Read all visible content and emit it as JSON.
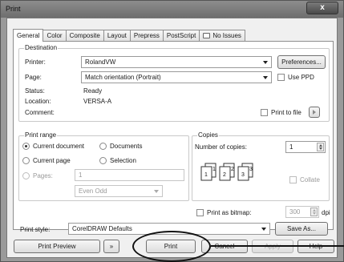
{
  "window": {
    "title": "Print",
    "close_glyph": "x"
  },
  "tabs": [
    {
      "label": "General",
      "active": true
    },
    {
      "label": "Color"
    },
    {
      "label": "Composite"
    },
    {
      "label": "Layout"
    },
    {
      "label": "Prepress"
    },
    {
      "label": "PostScript"
    },
    {
      "label": "No Issues",
      "icon": "no-issues-icon"
    }
  ],
  "destination": {
    "title": "Destination",
    "printer_label": "Printer:",
    "printer_value": "RolandVW",
    "preferences_button": "Preferences...",
    "page_label": "Page:",
    "page_value": "Match orientation (Portrait)",
    "use_ppd_label": "Use PPD",
    "status_label": "Status:",
    "status_value": "Ready",
    "location_label": "Location:",
    "location_value": "VERSA-A",
    "comment_label": "Comment:",
    "print_to_file_label": "Print to file"
  },
  "print_range": {
    "title": "Print range",
    "current_document": "Current document",
    "documents": "Documents",
    "current_page": "Current page",
    "selection": "Selection",
    "pages_label": "Pages:",
    "pages_value": "1",
    "even_odd_value": "Even Odd",
    "selected": "Current document"
  },
  "copies": {
    "title": "Copies",
    "number_label": "Number of copies:",
    "number_value": "1",
    "collate_label": "Collate",
    "collate_icon_labels": [
      "1",
      "1",
      "2",
      "2",
      "3",
      "3"
    ]
  },
  "bitmap": {
    "label": "Print as bitmap:",
    "value": "300",
    "unit": "dpi"
  },
  "style": {
    "label": "Print style:",
    "value": "CorelDRAW Defaults",
    "save_as_button": "Save As..."
  },
  "bottom_buttons": {
    "print_preview": "Print Preview",
    "print": "Print",
    "cancel": "Cancel",
    "apply": "Apply",
    "help": "Help"
  }
}
